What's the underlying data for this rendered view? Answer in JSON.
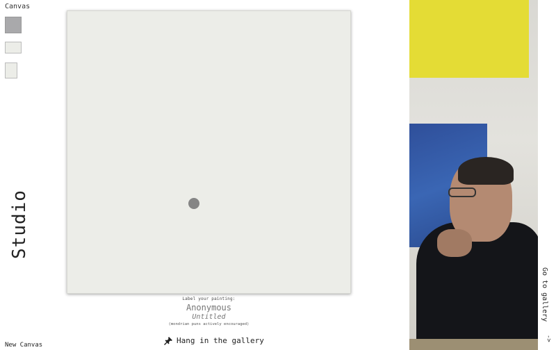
{
  "sidebar": {
    "canvas_title": "Canvas",
    "swatches": [
      "square",
      "landscape",
      "portrait"
    ],
    "studio_title": "Studio",
    "new_canvas": "New Canvas"
  },
  "labeling": {
    "prompt": "Label your painting:",
    "artist_placeholder": "Anonymous",
    "title_placeholder": "Untitled",
    "hint": "(mondrian puns actively encouraged)"
  },
  "actions": {
    "hang": "Hang in the gallery",
    "go_gallery": "Go to gallery",
    "arrow": "->"
  },
  "colors": {
    "canvas_bg": "#ecede8",
    "dot": "#858585",
    "yellow": "#e4dc35",
    "blue": "#3a66b4"
  }
}
